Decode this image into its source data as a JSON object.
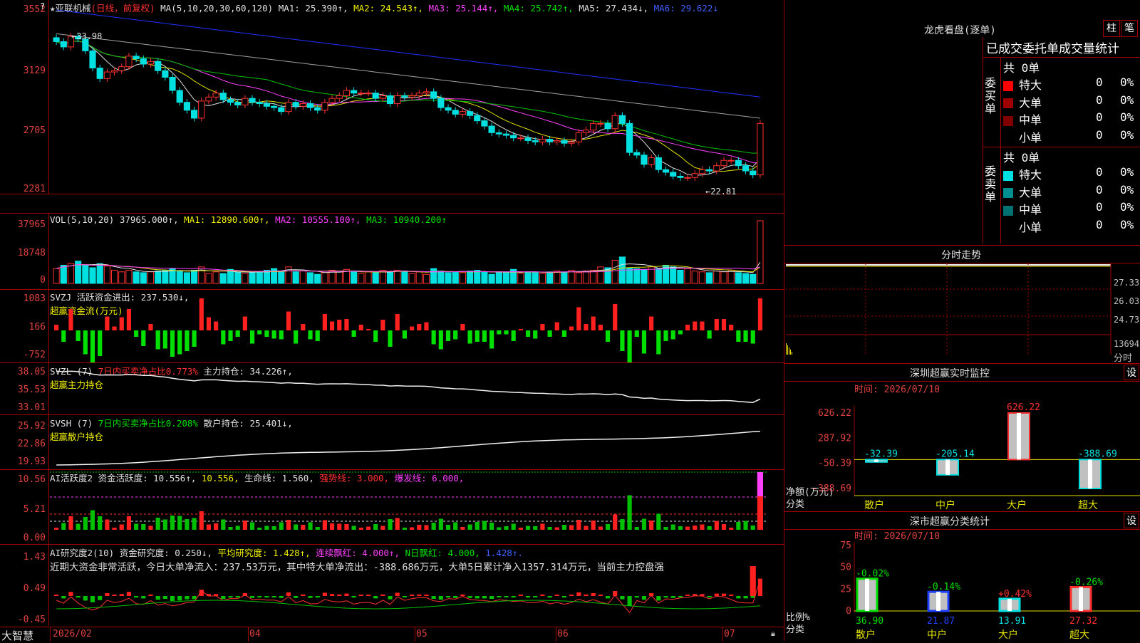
{
  "main": {
    "title_prefix": "★",
    "stock_name": "亚联机械",
    "period_note": "(日线，前复权)",
    "ma_header": "MA(5,10,20,30,60,120)",
    "ma1": "MA1: 25.390↑,",
    "ma2": "MA2: 24.543↑,",
    "ma3": "MA3: 25.144↑,",
    "ma4": "MA4: 25.742↑,",
    "ma5": "MA5: 27.434↓,",
    "ma6": "MA6: 29.622↓",
    "y_ticks": [
      "3552",
      "3129",
      "2705",
      "2281"
    ],
    "high_label": "33.98",
    "low_label": "22.81",
    "close_prices": [
      33.2,
      32.8,
      33.6,
      33.4,
      32.5,
      31.2,
      30.4,
      30.9,
      31.0,
      31.3,
      32.1,
      31.9,
      31.5,
      31.7,
      31.0,
      30.5,
      29.5,
      28.6,
      28.0,
      27.4,
      28.7,
      29.0,
      29.3,
      28.8,
      28.6,
      28.4,
      28.9,
      28.6,
      28.5,
      28.3,
      28.2,
      27.9,
      28.6,
      28.3,
      28.5,
      28.2,
      28.0,
      28.6,
      28.9,
      29.1,
      29.5,
      29.3,
      29.3,
      29.3,
      28.9,
      29.1,
      28.5,
      29.1,
      29.0,
      29.1,
      29.3,
      29.4,
      28.9,
      28.2,
      28.0,
      27.7,
      27.9,
      27.6,
      27.2,
      26.8,
      26.3,
      26.2,
      26.1,
      25.9,
      25.9,
      25.7,
      25.6,
      25.8,
      25.6,
      25.7,
      25.5,
      25.6,
      26.3,
      26.5,
      27.0,
      27.0,
      26.6,
      27.6,
      27.0,
      24.8,
      24.6,
      23.9,
      24.4,
      23.5,
      23.3,
      23.0,
      22.9,
      22.9,
      23.2,
      23.5,
      23.4,
      23.8,
      24.2,
      24.2,
      23.8,
      23.4,
      23.1,
      27.0
    ]
  },
  "vol": {
    "header": "VOL(5,10,20)",
    "vol_val": "37965.000↑,",
    "ma1": "MA1: 12890.600↑,",
    "ma2": "MA2: 10555.100↑,",
    "ma3": "MA3: 10940.200↑",
    "y_ticks": [
      "37965",
      "18748",
      "0"
    ],
    "values": [
      9000,
      11000,
      12000,
      13500,
      11000,
      9500,
      12000,
      10500,
      8000,
      7000,
      8000,
      7000,
      6500,
      7000,
      7500,
      8000,
      9000,
      7500,
      6500,
      8000,
      10000,
      6000,
      7000,
      6000,
      8500,
      7000,
      6000,
      6500,
      7000,
      8000,
      9000,
      7500,
      10000,
      7000,
      7500,
      6500,
      5500,
      6500,
      8000,
      7500,
      8500,
      7000,
      6000,
      7000,
      6500,
      8000,
      7000,
      8000,
      7500,
      6000,
      7000,
      5500,
      9000,
      7500,
      6500,
      7000,
      6500,
      7500,
      8000,
      7000,
      5500,
      6500,
      7000,
      8500,
      6000,
      7000,
      6500,
      6000,
      7000,
      7500,
      7000,
      8000,
      6500,
      7500,
      8000,
      10000,
      9500,
      14000,
      16000,
      9500,
      9000,
      8500,
      10000,
      9000,
      11000,
      10000,
      8000,
      9000,
      7500,
      7000,
      6500,
      7500,
      7000,
      8000,
      6500,
      6000,
      5500,
      37965
    ]
  },
  "svzj": {
    "header": "SVZJ",
    "label": "活跃资金进出: 237.530↓,",
    "sub": "超赢资金流(万元)",
    "y_ticks": [
      "1083",
      "166",
      "-752"
    ]
  },
  "svzl": {
    "header": "SVZL (7)",
    "ratio": "7日内买卖净占比0.773%",
    "label": "主力持仓: 34.226↑,",
    "sub": "超赢主力持仓",
    "y_ticks": [
      "38.05",
      "35.53",
      "33.01"
    ]
  },
  "svsh": {
    "header": "SVSH (7)",
    "ratio": "7日内买卖净占比0.208%",
    "label": "散户持仓: 25.401↓,",
    "sub": "超赢散户持仓",
    "y_ticks": [
      "25.92",
      "22.86",
      "19.93"
    ]
  },
  "ai1": {
    "header": "AI活跃度2",
    "label": "资金活跃度: 10.556↑,",
    "val2": "10.556,",
    "life": "生命线: 1.560,",
    "strong": "强势线: 3.000,",
    "burst": "爆发线: 6.000,",
    "y_ticks": [
      "10.56",
      "5.21",
      "0.00"
    ]
  },
  "ai2": {
    "header": "AI研究度2(10)",
    "label": "资金研究度: 0.250↓,",
    "avg": "平均研究度: 1.428↑,",
    "red": "连续飘红: 4.000↑,",
    "nred": "N日飘红: 4.000,",
    "last": "1.428↑.",
    "comment": "近期大资金非常活跃，今日大单净流入：237.53万元，其中特大单净流出：-388.686万元，大单5日累计净入1357.314万元，当前主力控盘强",
    "y_ticks": [
      "1.43",
      "0.49",
      "-0.45"
    ]
  },
  "bottom": {
    "app_name": "大智慧",
    "dates": [
      "2026/02",
      "04",
      "05",
      "06",
      "07"
    ]
  },
  "dragon_tiger": {
    "title": "龙虎看盘(逐单)",
    "btn_bar": "柱",
    "btn_pen": "笔",
    "subtitle": "已成交委托单成交量统计",
    "buy_label": "委买单",
    "sell_label": "委卖单",
    "buy_total": "共 0单",
    "sell_total": "共 0单",
    "rows_buy": [
      {
        "label": "特大",
        "count": "0",
        "pct": "0%",
        "color": "#ff0000"
      },
      {
        "label": "大单",
        "count": "0",
        "pct": "0%",
        "color": "#a00000"
      },
      {
        "label": "中单",
        "count": "0",
        "pct": "0%",
        "color": "#800000"
      },
      {
        "label": "小单",
        "count": "0",
        "pct": "0%",
        "color": "#000000"
      }
    ],
    "rows_sell": [
      {
        "label": "特大",
        "count": "0",
        "pct": "0%",
        "color": "#00e0e0"
      },
      {
        "label": "大单",
        "count": "0",
        "pct": "0%",
        "color": "#009090"
      },
      {
        "label": "中单",
        "count": "0",
        "pct": "0%",
        "color": "#007070"
      },
      {
        "label": "小单",
        "count": "0",
        "pct": "0%",
        "color": "#000000"
      }
    ]
  },
  "intraday": {
    "title": "分时走势",
    "ticks": [
      "27.33",
      "26.03",
      "24.73",
      "13694"
    ],
    "unit": "分时"
  },
  "monitor": {
    "title": "深圳超赢实时监控",
    "btn": "设",
    "date": "时间: 2026/07/10",
    "side_label": "净额(万元)",
    "side_label2": "分类",
    "y_ticks": [
      "626.22",
      "287.92",
      "-50.39",
      "-388.69"
    ],
    "bars": [
      {
        "name": "散户",
        "value": -32.39,
        "label": "-32.39"
      },
      {
        "name": "中户",
        "value": -205.14,
        "label": "-205.14"
      },
      {
        "name": "大户",
        "value": 626.22,
        "label": "626.22"
      },
      {
        "name": "超大",
        "value": -388.69,
        "label": "-388.69"
      }
    ]
  },
  "classify": {
    "title": "深市超赢分类统计",
    "btn": "设",
    "date": "时间: 2026/07/10",
    "side_label": "比例%",
    "side_label2": "分类",
    "y_ticks": [
      "75",
      "50",
      "25",
      "0"
    ],
    "bars": [
      {
        "name": "散户",
        "value": 36.9,
        "label": "36.90",
        "delta": "-0.02%",
        "color": "#00e000"
      },
      {
        "name": "中户",
        "value": 21.87,
        "label": "21.87",
        "delta": "-0.14%",
        "color": "#2040ff"
      },
      {
        "name": "大户",
        "value": 13.91,
        "label": "13.91",
        "delta": "+0.42%",
        "color": "#00e0e0"
      },
      {
        "name": "超大",
        "value": 27.32,
        "label": "27.32",
        "delta": "-0.26%",
        "color": "#ff3030"
      }
    ]
  }
}
